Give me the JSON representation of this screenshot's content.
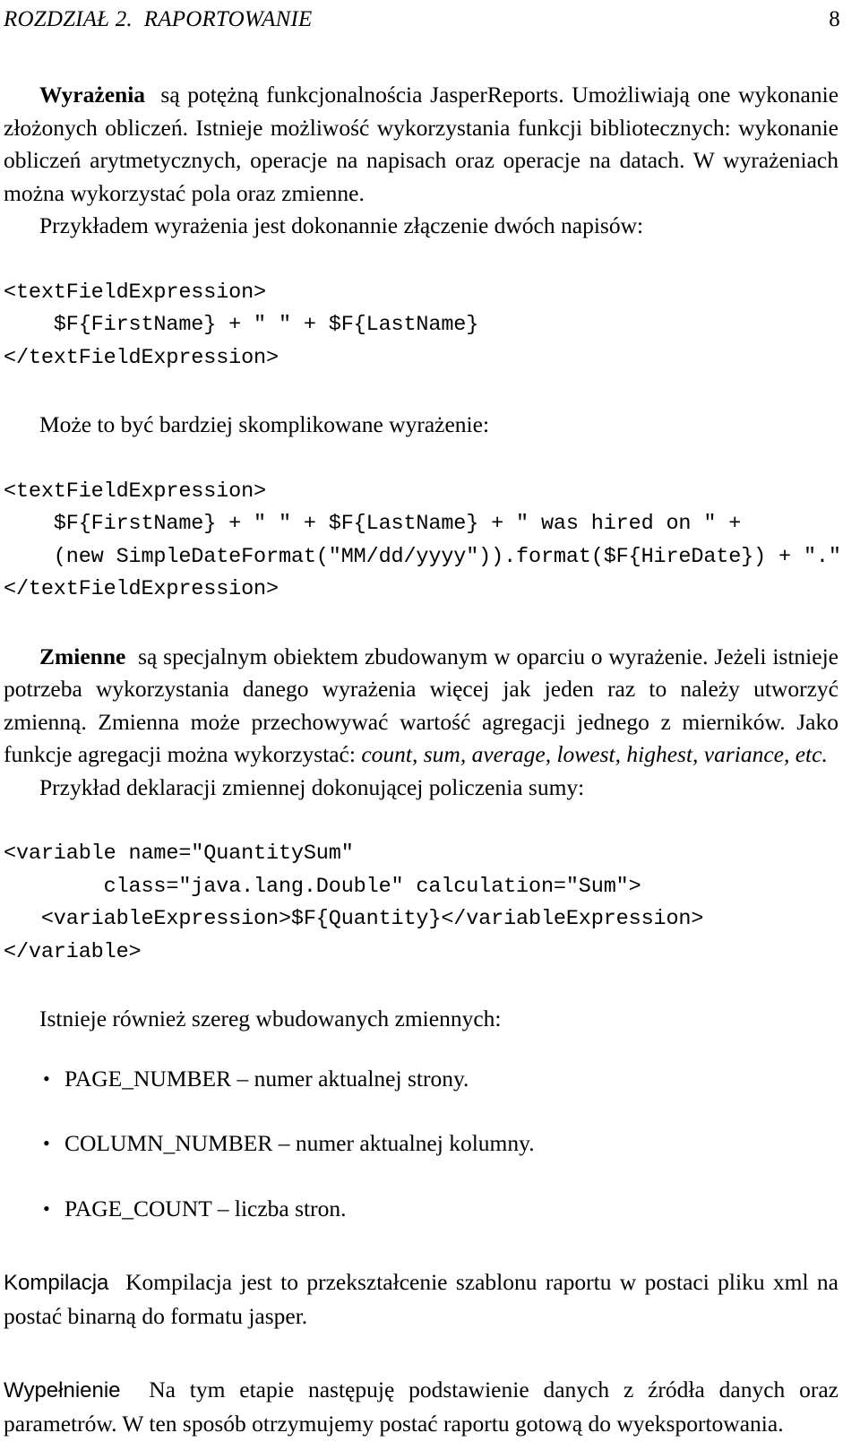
{
  "header": {
    "chapter_label": "ROZDZIAŁ 2.  RAPORTOWANIE",
    "page_number": "8"
  },
  "sections": {
    "expressions": {
      "lead": "Wyrażenia",
      "paragraph_1": "są potężną funkcjonalnościa JasperReports. Umożliwiają one wykonanie złożonych obliczeń. Istnieje możliwość wykorzystania funkcji bibliotecznych: wykonanie obliczeń arytmetycznych, operacje na napisach oraz operacje na datach. W wyrażeniach można wykorzystać pola oraz zmienne.",
      "paragraph_2": "Przykładem wyrażenia jest dokonannie złączenie dwóch napisów:",
      "code_1": "<textFieldExpression>\n    $F{FirstName} + \" \" + $F{LastName}\n</textFieldExpression>",
      "paragraph_3": "Może to być bardziej skomplikowane wyrażenie:",
      "code_2": "<textFieldExpression>\n    $F{FirstName} + \" \" + $F{LastName} + \" was hired on \" +\n    (new SimpleDateFormat(\"MM/dd/yyyy\")).format($F{HireDate}) + \".\"\n</textFieldExpression>"
    },
    "variables": {
      "lead": "Zmienne",
      "paragraph_1_before_italics": "są specjalnym obiektem zbudowanym w oparciu o wyrażenie. Jeżeli istnieje potrzeba wykorzystania danego wyrażenia więcej jak jeden raz to należy utworzyć zmienną. Zmienna może przechowywać wartość agregacji jednego z mierników. Jako funkcje agregacji można wykorzystać: ",
      "paragraph_1_italics": "count, sum, average, lowest, highest, variance, etc.",
      "paragraph_2": "Przykład deklaracji zmiennej dokonującej policzenia sumy:",
      "code_1": "<variable name=\"QuantitySum\"\n        class=\"java.lang.Double\" calculation=\"Sum\">\n   <variableExpression>$F{Quantity}</variableExpression>\n</variable>",
      "paragraph_3": "Istnieje również szereg wbudowanych zmiennych:",
      "builtin_list": [
        "PAGE_NUMBER – numer aktualnej strony.",
        "COLUMN_NUMBER – numer aktualnej kolumny.",
        "PAGE_COUNT – liczba stron."
      ],
      "bullet_glyph": "•"
    },
    "compilation": {
      "lead": "Kompilacja",
      "paragraph": "Kompilacja jest to przekształcenie szablonu raportu w postaci pliku xml na postać binarną do formatu jasper."
    },
    "filling": {
      "lead": "Wypełnienie",
      "paragraph": "Na tym etapie następuję podstawienie danych z źródła danych oraz parametrów. W ten sposób otrzymujemy postać raportu gotową do wyeksportowania."
    }
  }
}
